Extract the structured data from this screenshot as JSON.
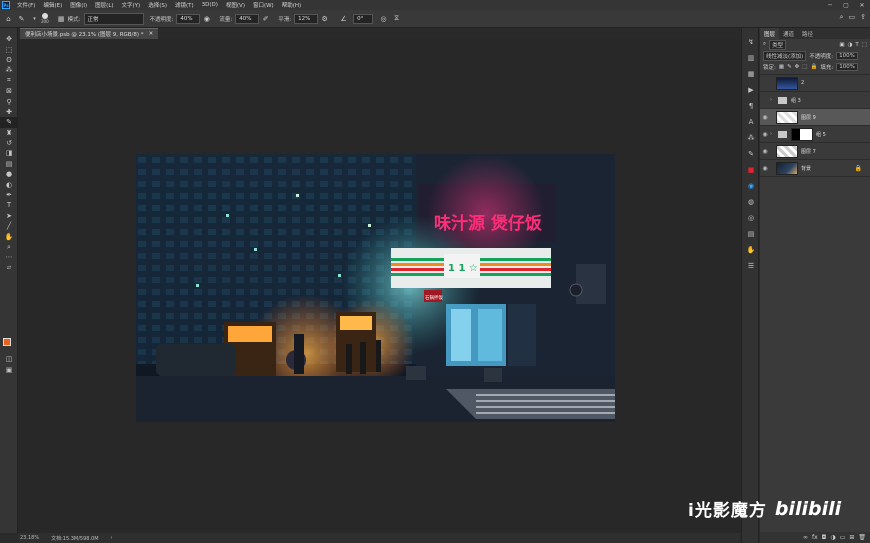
{
  "menubar": {
    "logo": "Ps",
    "items": [
      "文件(F)",
      "编辑(E)",
      "图像(I)",
      "图层(L)",
      "文字(Y)",
      "选择(S)",
      "滤镜(T)",
      "3D(D)",
      "视图(V)",
      "窗口(W)",
      "帮助(H)"
    ]
  },
  "options": {
    "brush_size": "200",
    "mode_label": "模式:",
    "mode_value": "正常",
    "opacity_label": "不透明度:",
    "opacity_value": "40%",
    "flow_label": "流量:",
    "flow_value": "40%",
    "smooth_label": "平滑:",
    "smooth_value": "12%",
    "angle_value": "0°"
  },
  "document": {
    "tab_title": "便利店小场景.psb @ 23.1% (图层 9, RGB/8) *",
    "zoom": "23.18%",
    "doc_info": "文档:15.3M/598.0M"
  },
  "artwork": {
    "sign_text": "味汁源 煲仔饭",
    "store_logo": "1 1 ☆",
    "small_sign": "石锅拌饭",
    "colors": {
      "neon_pink": "#ff2d78",
      "neon_yellow": "#ffe34a",
      "stripe_green": "#15a35c",
      "stripe_red": "#e0242f",
      "stripe_orange": "#f08a1c"
    }
  },
  "layers_panel": {
    "tabs": [
      "图层",
      "通道",
      "路径"
    ],
    "filter_kind": "类型",
    "blend_mode": "线性减淡(添加)",
    "opacity_label": "不透明度:",
    "opacity_value": "100%",
    "lock_label": "锁定:",
    "fill_label": "填充:",
    "fill_value": "100%",
    "layers": [
      {
        "name": "2"
      },
      {
        "name": "组 3"
      },
      {
        "name": "图层 9"
      },
      {
        "name": "组 5"
      },
      {
        "name": "图层 7"
      },
      {
        "name": "背景"
      }
    ]
  },
  "watermark": {
    "text": "i光影魔方",
    "brand": "bilibili"
  }
}
